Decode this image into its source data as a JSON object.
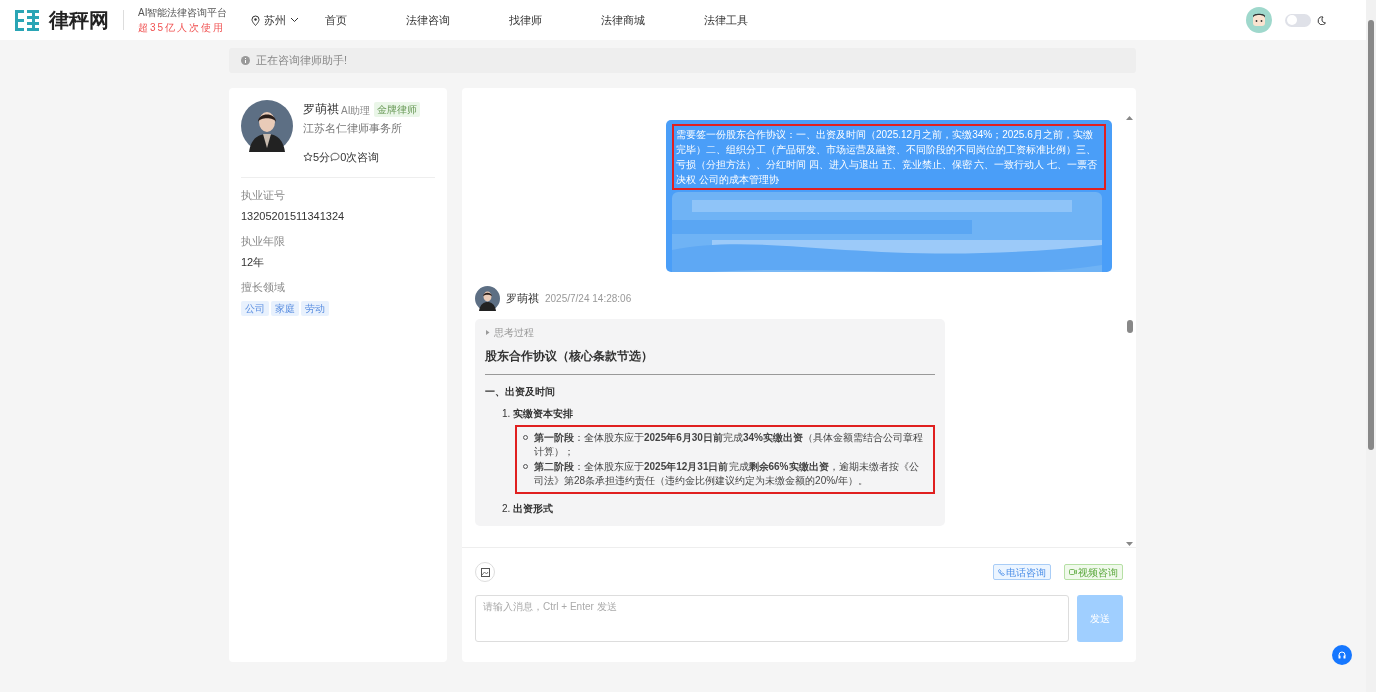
{
  "header": {
    "logo_text": "律秤网",
    "slogan": "AI智能法律咨询平台",
    "tagline": "超35亿人次使用",
    "city": "苏州",
    "nav": [
      {
        "label": "首页",
        "selected": false
      },
      {
        "label": "法律咨询",
        "selected": false
      },
      {
        "label": "找律师",
        "selected": false
      },
      {
        "label": "法律商城",
        "selected": false
      },
      {
        "label": "法律工具",
        "selected": false
      }
    ],
    "dark_mode": {
      "on": false
    }
  },
  "notice": "正在咨询律师助手!",
  "lawyer": {
    "name": "罗萌祺",
    "role": "AI助理",
    "badge": "金牌律师",
    "firm": "江苏名仁律师事务所",
    "rating": "5分",
    "consults": "0次咨询",
    "fields": [
      {
        "label": "执业证号",
        "value": "13205201511341324"
      },
      {
        "label": "执业年限",
        "value": "12年"
      }
    ],
    "specialty_label": "擅长领域",
    "specialties": [
      "公司",
      "家庭",
      "劳动"
    ]
  },
  "chat": {
    "user_message": "需要签一份股东合作协议：一、出资及时间（2025.12月之前，实缴34%；2025.6月之前，实缴完毕）二、组织分工（产品研发、市场运营及融资、不同阶段的不同岗位的工资标准比例）三、亏损（分担方法）、分红时间 四、进入与退出 五、竞业禁止、保密 六、一致行动人 七、一票否决权 公司的成本管理协",
    "reply": {
      "name": "罗萌祺",
      "time": "2025/7/24 14:28:06",
      "thinking": {
        "label": "思考过程",
        "expanded": false
      },
      "blocks": [
        {
          "kind": "title",
          "text": "股东合作协议（核心条款节选）"
        },
        {
          "kind": "section",
          "text": "一、出资及时间"
        },
        {
          "kind": "numbered",
          "number": "1.",
          "text": "实缴资本安排"
        },
        {
          "kind": "bullets",
          "highlighted": true,
          "items": [
            "**第一阶段**：全体股东应于**2025年6月30日前**完成**34%实缴出资**（具体金额需结合公司章程计算）；",
            "**第二阶段**：全体股东应于**2025年12月31日前**完成**剩余66%实缴出资**，逾期未缴者按《公司法》第28条承担违约责任（违约金比例建议约定为未缴金额的20%/年）。"
          ]
        },
        {
          "kind": "numbered",
          "number": "2.",
          "text": "出资形式"
        }
      ]
    }
  },
  "actions": {
    "phone": "电话咨询",
    "video": "视频咨询",
    "input_placeholder": "请输入消息，Ctrl + Enter 发送",
    "send": {
      "label": "发送",
      "disabled": true
    }
  }
}
